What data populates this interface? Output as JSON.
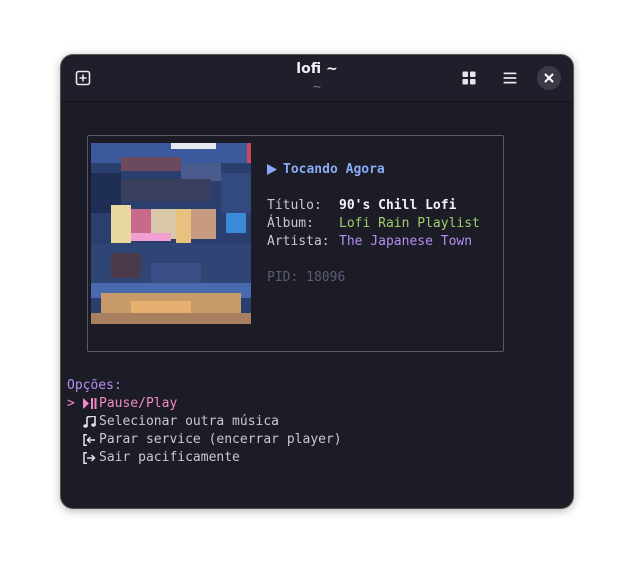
{
  "window": {
    "title": "lofi ~",
    "subtitle": "~"
  },
  "player": {
    "heading": "Tocando Agora",
    "labels": {
      "title": "Título:",
      "album": "Álbum:",
      "artist": "Artista:"
    },
    "values": {
      "title": "90's Chill Lofi",
      "album": "Lofi Rain Playlist",
      "artist": "The Japanese Town"
    },
    "pid": "PID: 18096"
  },
  "options": {
    "heading": "Opções:",
    "selected_marker": ">",
    "items": [
      {
        "label": "Pause/Play",
        "icon": "play-pause-icon",
        "selected": true
      },
      {
        "label": "Selecionar outra música",
        "icon": "music-note-icon",
        "selected": false
      },
      {
        "label": "Parar service (encerrar player)",
        "icon": "stop-exit-icon",
        "selected": false
      },
      {
        "label": "Sair pacificamente",
        "icon": "sign-out-icon",
        "selected": false
      }
    ]
  },
  "colors": {
    "accent_blue": "#8aaaf5",
    "album_green": "#9ecf6b",
    "artist_purple": "#b48ef0",
    "selection_pink": "#f08ac8",
    "pid_gray": "#5c5c78"
  }
}
